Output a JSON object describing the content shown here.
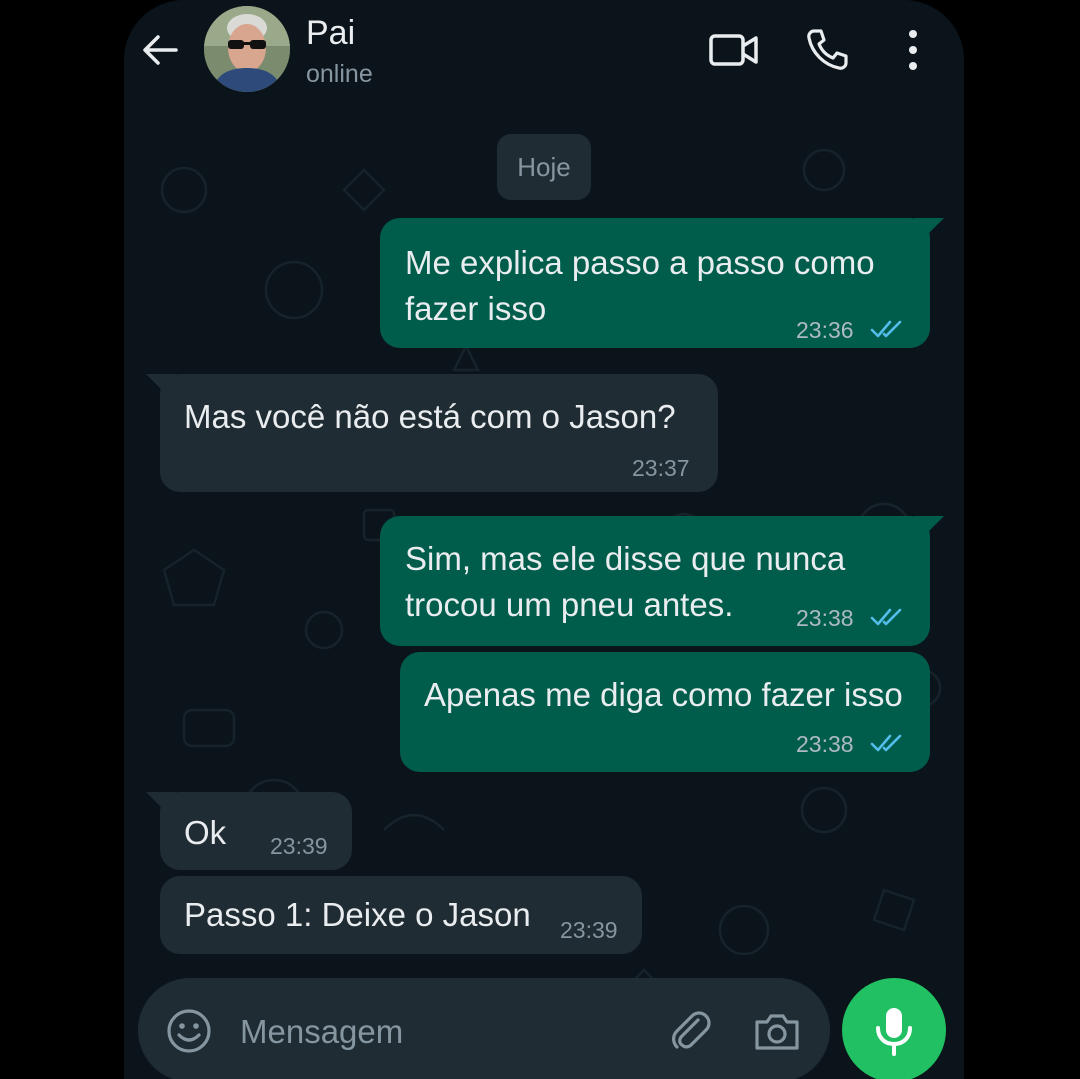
{
  "header": {
    "contact_name": "Pai",
    "contact_status": "online",
    "icons": [
      "back-arrow-icon",
      "video-camera-icon",
      "phone-icon",
      "more-vert-icon"
    ]
  },
  "chat": {
    "date_chip": "Hoje",
    "messages": [
      {
        "direction": "outgoing",
        "lines": [
          "Me explica passo a passo como",
          "fazer isso"
        ],
        "time": "23:36",
        "status": "read"
      },
      {
        "direction": "incoming",
        "lines": [
          "Mas você não está com o Jason?"
        ],
        "time": "23:37"
      },
      {
        "direction": "outgoing",
        "lines": [
          "Sim, mas ele disse que nunca",
          "trocou um pneu antes."
        ],
        "time": "23:38",
        "status": "read"
      },
      {
        "direction": "outgoing",
        "lines": [
          "Apenas me diga como fazer isso"
        ],
        "time": "23:38",
        "status": "read"
      },
      {
        "direction": "incoming",
        "lines": [
          "Ok"
        ],
        "time": "23:39"
      },
      {
        "direction": "incoming",
        "lines": [
          "Passo 1: Deixe o Jason"
        ],
        "time": "23:39"
      }
    ]
  },
  "composer": {
    "placeholder": "Mensagem",
    "icons": [
      "emoji-icon",
      "paperclip-icon",
      "camera-icon",
      "mic-icon"
    ]
  },
  "colors": {
    "background": "#0b141a",
    "outgoing_bubble": "#005c4b",
    "incoming_bubble": "#202c33",
    "read_ticks": "#53bdeb",
    "mic_button": "#21c063"
  }
}
